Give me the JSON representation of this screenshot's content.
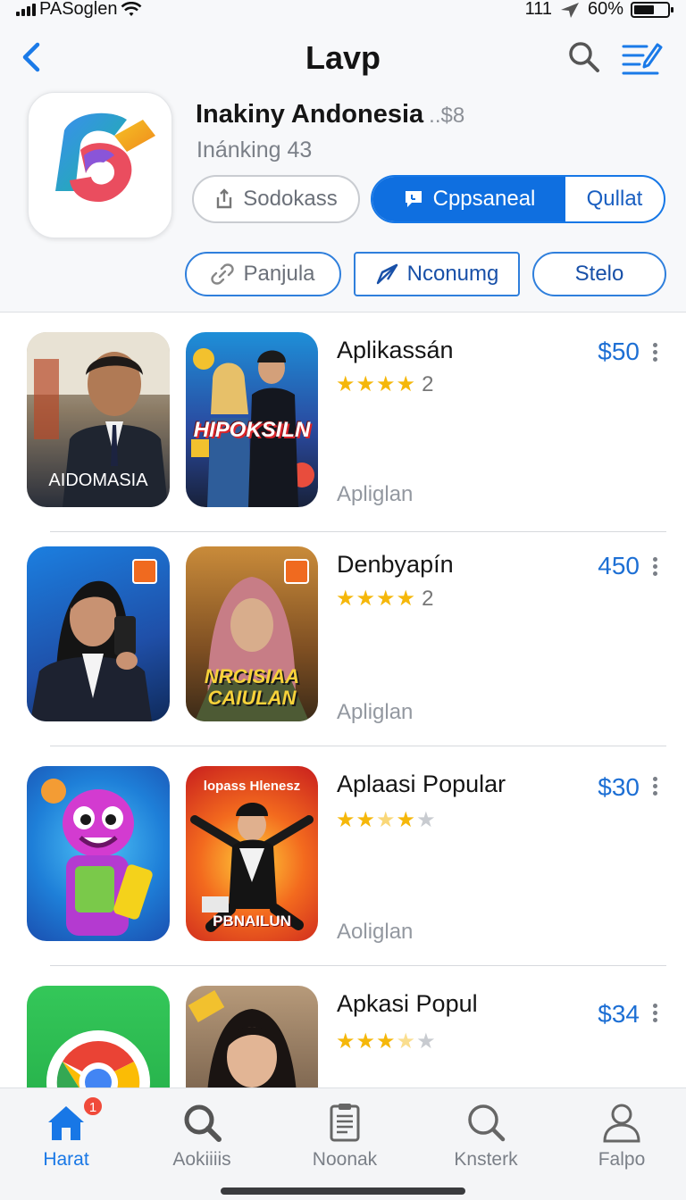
{
  "status_bar": {
    "carrier": "PASoglen",
    "time": "111",
    "battery": "60%",
    "battery_level": 0.6
  },
  "header": {
    "title": "Lavp"
  },
  "app": {
    "name": "Inakiny Andonesia",
    "price": "..$8",
    "subtitle": "Inánking 43",
    "buttons": {
      "sodokass": "Sodokass",
      "segment_active": "Cppsaneal",
      "segment_inactive": "Qullat",
      "panjula": "Panjula",
      "nconumg": "Nconumg",
      "stelo": "Stelo"
    },
    "colors": {
      "accent": "#0f6fe0",
      "star": "#f5b70a"
    }
  },
  "apps": [
    {
      "title": "Aplikassán",
      "rating": 4,
      "rating_count": "2",
      "subtitle": "Apliglan",
      "price": "$50",
      "thumb_a_text": "AIDOMASIA",
      "thumb_b_text": "HIPOKSILN"
    },
    {
      "title": "Denbyapín",
      "rating": 4,
      "rating_count": "2",
      "subtitle": "Apliglan",
      "price": "450",
      "thumb_a_text": "",
      "thumb_b_text": "NRCISIAA CAIULAN"
    },
    {
      "title": "Aplaasi Popular",
      "rating": 3.5,
      "rating_count": "",
      "subtitle": "Aoliglan",
      "price": "$30",
      "thumb_a_text": "",
      "thumb_b_text": "lopass Hlenesz",
      "thumb_b_caption": "PBNAILUN"
    },
    {
      "title": "Apkasi Popul",
      "rating": 3.5,
      "rating_count": "",
      "subtitle": "",
      "price": "$34",
      "thumb_a_text": "",
      "thumb_b_text": ""
    }
  ],
  "tabs": [
    {
      "label": "Harat",
      "icon": "home-icon",
      "badge": "1",
      "active": true
    },
    {
      "label": "Aokiiiis",
      "icon": "search-icon"
    },
    {
      "label": "Noonak",
      "icon": "clipboard-icon"
    },
    {
      "label": "Knsterk",
      "icon": "search-icon"
    },
    {
      "label": "Falpo",
      "icon": "person-icon"
    }
  ]
}
